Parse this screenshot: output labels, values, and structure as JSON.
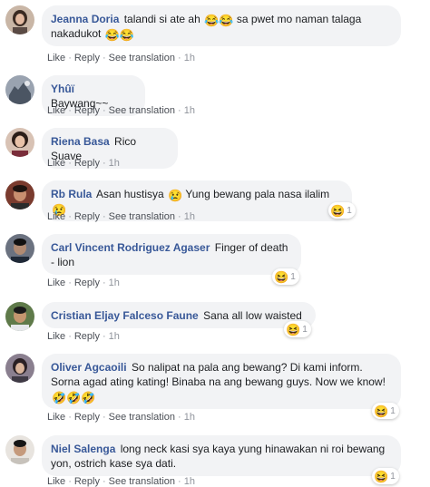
{
  "actions": {
    "like": "Like",
    "reply": "Reply",
    "see_translation": "See translation",
    "separator": "·"
  },
  "reaction_emoji": "😆",
  "comments": [
    {
      "author": "Jeanna Doria",
      "text1": "talandi si ate ah",
      "emoji1": "😂😂",
      "text2": "sa pwet mo naman talaga nakadukot",
      "emoji2": "😂😂",
      "time": "1h",
      "show_translation": true
    },
    {
      "author": "Yhûï",
      "text1": "Baywang~~",
      "time": "1h",
      "show_translation": true
    },
    {
      "author": "Riena Basa",
      "text1": "Rico Suave",
      "time": "1h",
      "show_translation": false
    },
    {
      "author": "Rb Rula",
      "text1": "Asan hustisya",
      "emoji1": "😢",
      "text2": "Yung bewang pala nasa ilalim",
      "emoji2": "😢",
      "time": "1h",
      "show_translation": true,
      "reaction_count": "1"
    },
    {
      "author": "Carl Vincent Rodriguez Agaser",
      "text1": "Finger of death - lion",
      "time": "1h",
      "show_translation": false,
      "reaction_count": "1"
    },
    {
      "author": "Cristian Eljay Falceso Faune",
      "text1": "Sana all low waisted",
      "time": "1h",
      "show_translation": false,
      "reaction_count": "1"
    },
    {
      "author": "Oliver Agcaoili",
      "text1": "So nalipat na pala ang bewang? Di kami inform. Sorna agad ating kating! Binaba na ang bewang guys. Now we know!",
      "emoji1": "🤣🤣🤣",
      "time": "1h",
      "show_translation": true,
      "reaction_count": "1"
    },
    {
      "author": "Niel Salenga",
      "text1": "long neck kasi sya kaya yung hinawakan ni roi bewang yon, ostrich kase sya dati.",
      "time": "1h",
      "show_translation": true,
      "reaction_count": "1"
    }
  ]
}
